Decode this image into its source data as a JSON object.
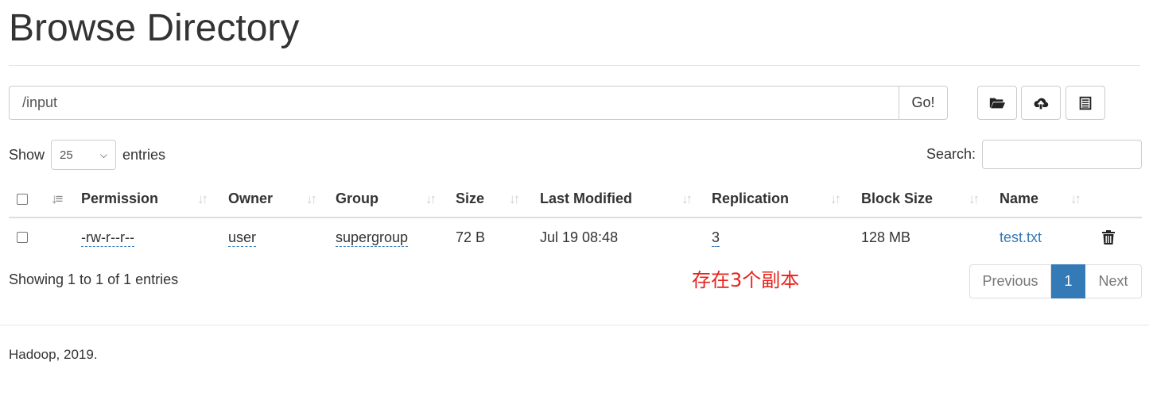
{
  "page": {
    "title": "Browse Directory"
  },
  "path_bar": {
    "value": "/input",
    "go_label": "Go!"
  },
  "toolbar": {
    "buttons": [
      {
        "icon": "folder-open-icon"
      },
      {
        "icon": "cloud-upload-icon"
      },
      {
        "icon": "list-icon"
      }
    ]
  },
  "entries": {
    "show_label": "Show",
    "selected": "25",
    "suffix": "entries"
  },
  "search": {
    "label": "Search:",
    "value": ""
  },
  "table": {
    "columns": [
      "Permission",
      "Owner",
      "Group",
      "Size",
      "Last Modified",
      "Replication",
      "Block Size",
      "Name"
    ],
    "rows": [
      {
        "permission": "-rw-r--r--",
        "owner": "user",
        "group": "supergroup",
        "size": "72 B",
        "last_modified": "Jul 19 08:48",
        "replication": "3",
        "block_size": "128 MB",
        "name": "test.txt"
      }
    ]
  },
  "info": {
    "showing": "Showing 1 to 1 of 1 entries"
  },
  "annotation": {
    "text": "存在3个副本",
    "color": "#e8231d"
  },
  "pagination": {
    "previous": "Previous",
    "current": "1",
    "next": "Next"
  },
  "footer": {
    "text": "Hadoop, 2019."
  },
  "colors": {
    "link": "#337ab7",
    "active_page": "#337ab7"
  }
}
